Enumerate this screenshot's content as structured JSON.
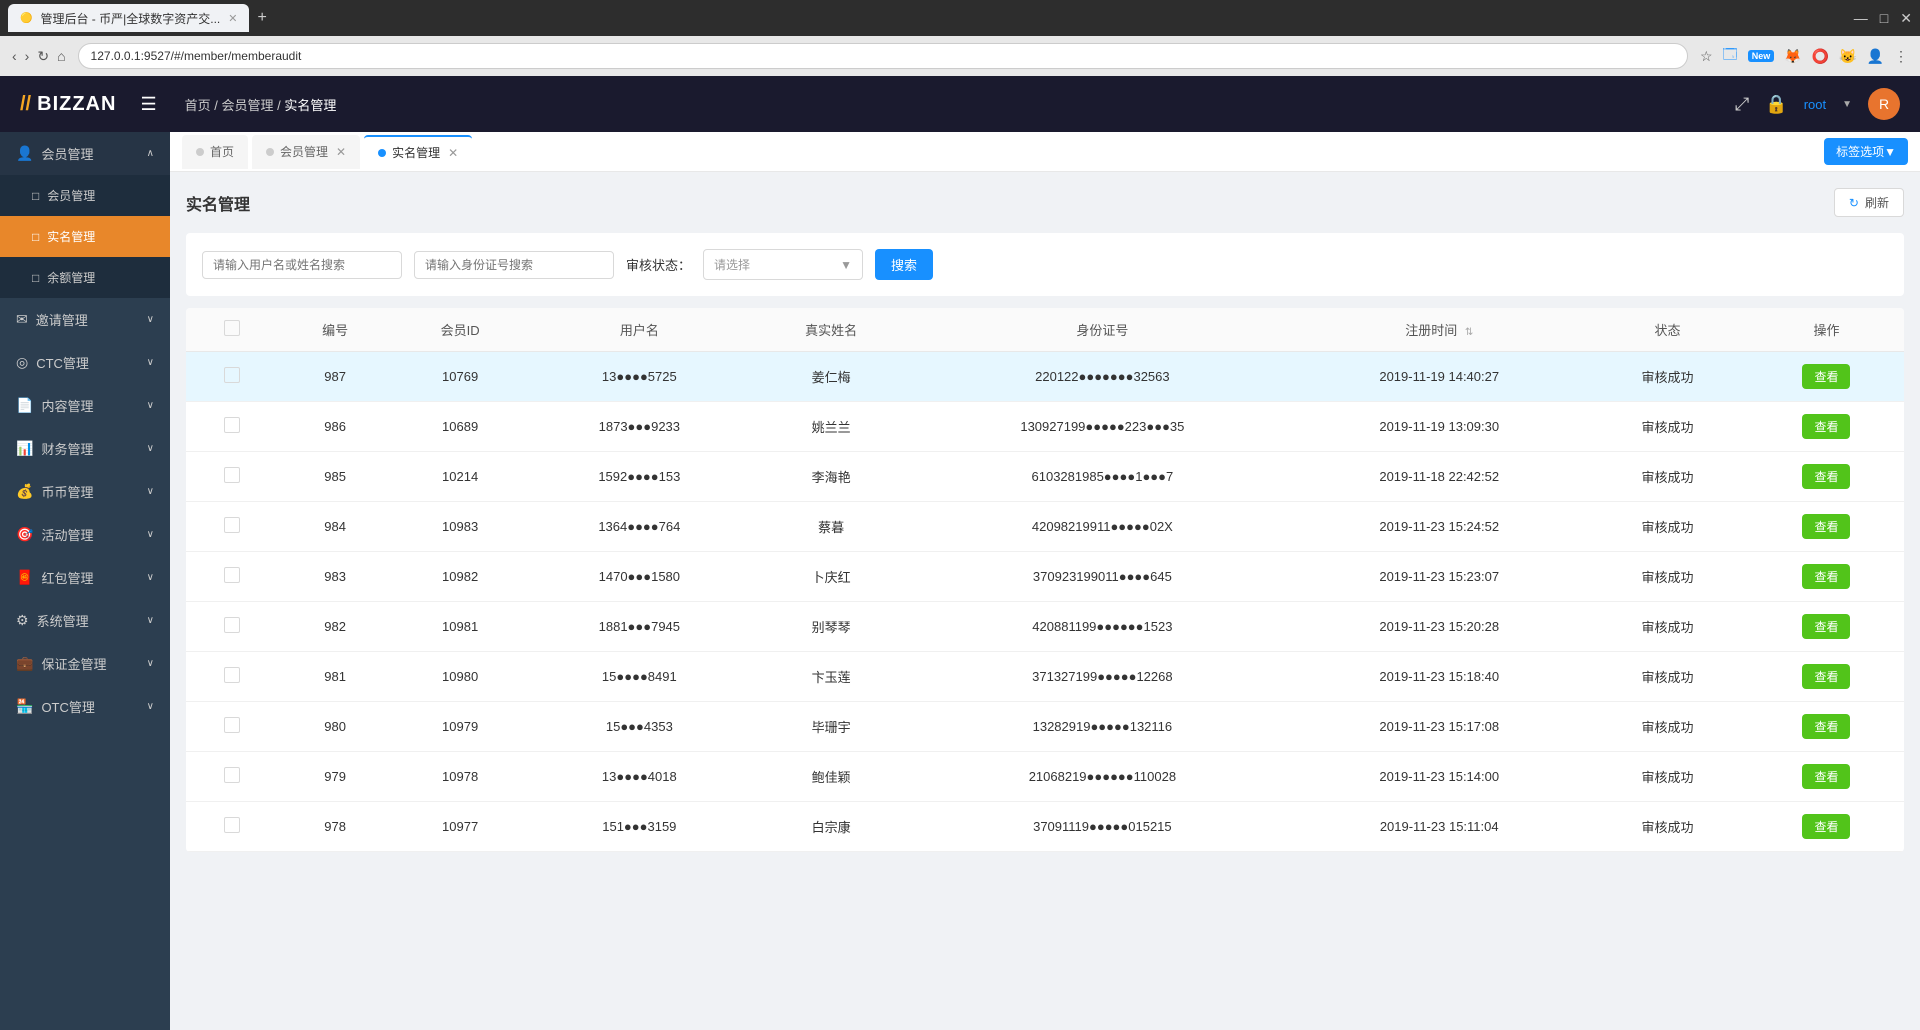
{
  "browser": {
    "tab_label": "管理后台 - 币严|全球数字资产交...",
    "url": "127.0.0.1:9527/#/member/memberaudit",
    "new_badge": "New"
  },
  "app": {
    "logo": "BIZZAN",
    "breadcrumb": [
      "首页",
      "会员管理",
      "实名管理"
    ],
    "user": "root",
    "fullscreen_icon": "⤢",
    "lock_icon": "🔒"
  },
  "sidebar": {
    "items": [
      {
        "id": "member",
        "icon": "👤",
        "label": "会员管理",
        "expanded": true
      },
      {
        "id": "member-mgmt",
        "icon": "□",
        "label": "会员管理",
        "sub": true
      },
      {
        "id": "realname-mgmt",
        "icon": "□",
        "label": "实名管理",
        "sub": true,
        "active": true
      },
      {
        "id": "balance-mgmt",
        "icon": "□",
        "label": "余额管理",
        "sub": true
      },
      {
        "id": "invite",
        "icon": "✉",
        "label": "邀请管理",
        "expanded": false
      },
      {
        "id": "ctc",
        "icon": "◎",
        "label": "CTC管理",
        "expanded": false
      },
      {
        "id": "content",
        "icon": "📄",
        "label": "内容管理",
        "expanded": false
      },
      {
        "id": "finance",
        "icon": "📊",
        "label": "财务管理",
        "expanded": false
      },
      {
        "id": "coin",
        "icon": "💰",
        "label": "币币管理",
        "expanded": false
      },
      {
        "id": "activity",
        "icon": "🎯",
        "label": "活动管理",
        "expanded": false
      },
      {
        "id": "redpacket",
        "icon": "🧧",
        "label": "红包管理",
        "expanded": false
      },
      {
        "id": "system",
        "icon": "⚙",
        "label": "系统管理",
        "expanded": false
      },
      {
        "id": "margin",
        "icon": "💼",
        "label": "保证金管理",
        "expanded": false
      },
      {
        "id": "otc",
        "icon": "🏪",
        "label": "OTC管理",
        "expanded": false
      }
    ]
  },
  "tabs": [
    {
      "id": "home",
      "label": "首页",
      "active": false,
      "closable": false
    },
    {
      "id": "member-mgmt",
      "label": "会员管理",
      "active": false,
      "closable": true
    },
    {
      "id": "realname-mgmt",
      "label": "实名管理",
      "active": true,
      "closable": true
    }
  ],
  "tag_select_btn": "标签选项▼",
  "page": {
    "title": "实名管理",
    "refresh_btn": "刷新"
  },
  "search": {
    "username_placeholder": "请输入用户名或姓名搜索",
    "id_placeholder": "请输入身份证号搜索",
    "status_label": "审核状态：",
    "status_placeholder": "请选择",
    "search_btn": "搜索"
  },
  "table": {
    "columns": [
      "编号",
      "会员ID",
      "用户名",
      "真实姓名",
      "身份证号",
      "注册时间",
      "状态",
      "操作"
    ],
    "rows": [
      {
        "id": "987",
        "member_id": "10769",
        "username": "13●●●●5725",
        "realname": "姜仁梅",
        "id_no": "220122●●●●●●●32563",
        "reg_time": "2019-11-19 14:40:27",
        "status": "审核成功",
        "highlighted": true
      },
      {
        "id": "986",
        "member_id": "10689",
        "username": "1873●●●9233",
        "realname": "姚兰兰",
        "id_no": "130927199●●●●●223●●●35",
        "reg_time": "2019-11-19 13:09:30",
        "status": "审核成功",
        "highlighted": false
      },
      {
        "id": "985",
        "member_id": "10214",
        "username": "1592●●●●153",
        "realname": "李海艳",
        "id_no": "6103281985●●●●1●●●7",
        "reg_time": "2019-11-18 22:42:52",
        "status": "审核成功",
        "highlighted": false
      },
      {
        "id": "984",
        "member_id": "10983",
        "username": "1364●●●●764",
        "realname": "蔡暮",
        "id_no": "42098219911●●●●●02X",
        "reg_time": "2019-11-23 15:24:52",
        "status": "审核成功",
        "highlighted": false
      },
      {
        "id": "983",
        "member_id": "10982",
        "username": "1470●●●1580",
        "realname": "卜庆红",
        "id_no": "370923199011●●●●645",
        "reg_time": "2019-11-23 15:23:07",
        "status": "审核成功",
        "highlighted": false
      },
      {
        "id": "982",
        "member_id": "10981",
        "username": "1881●●●7945",
        "realname": "别琴琴",
        "id_no": "420881199●●●●●●1523",
        "reg_time": "2019-11-23 15:20:28",
        "status": "审核成功",
        "highlighted": false
      },
      {
        "id": "981",
        "member_id": "10980",
        "username": "15●●●●8491",
        "realname": "卞玉莲",
        "id_no": "371327199●●●●●12268",
        "reg_time": "2019-11-23 15:18:40",
        "status": "审核成功",
        "highlighted": false
      },
      {
        "id": "980",
        "member_id": "10979",
        "username": "15●●●4353",
        "realname": "毕珊宇",
        "id_no": "13282919●●●●●132116",
        "reg_time": "2019-11-23 15:17:08",
        "status": "审核成功",
        "highlighted": false
      },
      {
        "id": "979",
        "member_id": "10978",
        "username": "13●●●●4018",
        "realname": "鲍佳颖",
        "id_no": "21068219●●●●●●110028",
        "reg_time": "2019-11-23 15:14:00",
        "status": "审核成功",
        "highlighted": false
      },
      {
        "id": "978",
        "member_id": "10977",
        "username": "151●●●3159",
        "realname": "白宗康",
        "id_no": "37091119●●●●●015215",
        "reg_time": "2019-11-23 15:11:04",
        "status": "审核成功",
        "highlighted": false
      }
    ],
    "view_btn": "查看"
  }
}
